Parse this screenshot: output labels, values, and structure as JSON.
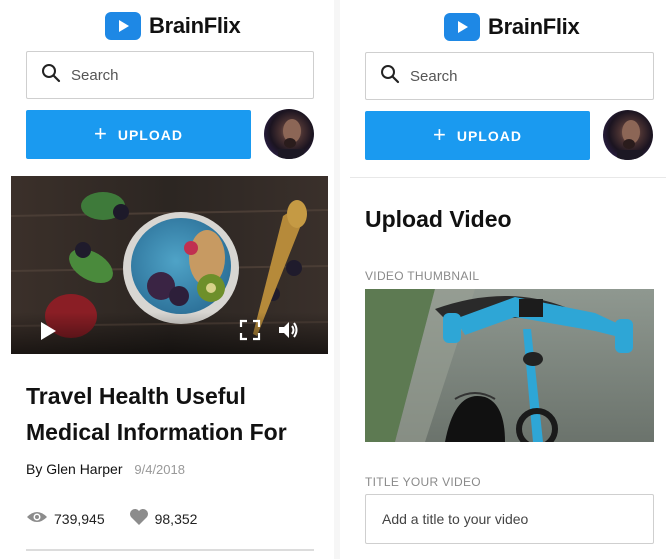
{
  "brand": {
    "name": "BrainFlix",
    "accent_color": "#1e88e5"
  },
  "search": {
    "placeholder": "Search",
    "icon": "search-icon"
  },
  "upload_button": {
    "label": "UPLOAD",
    "icon": "plus-icon",
    "color": "#1a9af0"
  },
  "avatar": {
    "icon": "avatar"
  },
  "video_player": {
    "controls": [
      "play-icon",
      "fullscreen-icon",
      "volume-icon"
    ]
  },
  "article": {
    "title": "Travel Health Useful Medical Information For",
    "author": "By Glen Harper",
    "date": "9/4/2018",
    "views": "739,945",
    "likes": "98,352"
  },
  "upload_page": {
    "title": "Upload Video",
    "thumbnail_label": "VIDEO THUMBNAIL",
    "title_label": "TITLE YOUR VIDEO",
    "title_placeholder": "Add a title to your video"
  }
}
